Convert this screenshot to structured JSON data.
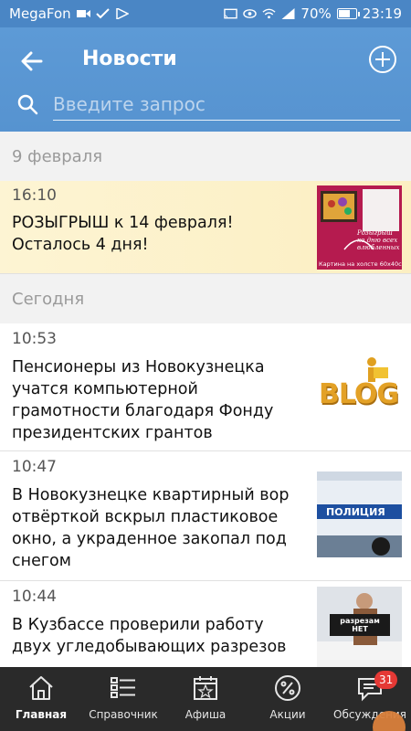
{
  "status_bar": {
    "carrier": "MegaFon",
    "battery": "70%",
    "battery_level": 0.7,
    "time": "23:19"
  },
  "header": {
    "title": "Новости",
    "search_placeholder": "Введите запрос",
    "background": "#5b9bd5"
  },
  "feed": {
    "sections": [
      {
        "date": "9 февраля"
      },
      {
        "date": "Сегодня"
      }
    ],
    "items": [
      {
        "time": "16:10",
        "title": "РОЗЫГРЫШ к 14 февраля! Осталось 4 дня!",
        "thumb_text": "Розыгрыш ко дню всех влюбленных",
        "thumb_caption": "Картина на холсте 60х40см"
      },
      {
        "time": "10:53",
        "title": "Пенсионеры из Новокузнецка учатся компьютерной грамотности благодаря Фонду президентских грантов",
        "thumb_text": "BLOG"
      },
      {
        "time": "10:47",
        "title": "В Новокузнецке квартирный вор отвёрткой вскрыл пластиковое окно, а украденное закопал под снегом",
        "thumb_text": "ПОЛИЦИЯ"
      },
      {
        "time": "10:44",
        "title": "В Кузбассе проверили работу двух угледобывающих разрезов",
        "thumb_text": "разрезам НЕТ"
      }
    ]
  },
  "bottom_nav": {
    "items": [
      {
        "label": "Главная",
        "icon": "home-icon"
      },
      {
        "label": "Справочник",
        "icon": "list-icon"
      },
      {
        "label": "Афиша",
        "icon": "calendar-star-icon"
      },
      {
        "label": "Акции",
        "icon": "percent-icon"
      },
      {
        "label": "Обсуждения",
        "icon": "chat-icon",
        "badge": "31"
      }
    ]
  }
}
